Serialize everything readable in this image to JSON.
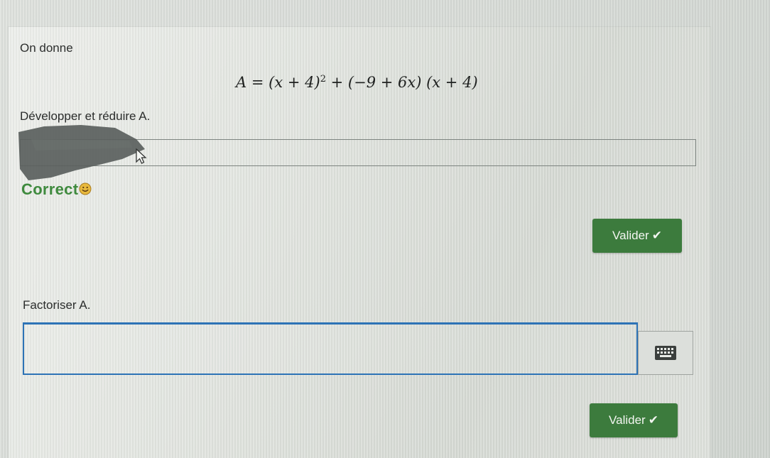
{
  "exercise": {
    "intro": "On donne",
    "formula": {
      "lhs": "A",
      "parts": [
        "(x + 4)",
        "2",
        "+ (−9 + 6x) (x + 4)"
      ]
    },
    "question1": {
      "prompt": "Développer et réduire A.",
      "feedback": "Correct",
      "validate_label": "Valider"
    },
    "question2": {
      "prompt": "Factoriser A.",
      "answer_value": "",
      "validate_label": "Valider"
    }
  },
  "icons": {
    "check": "check-icon",
    "keyboard": "keyboard-icon",
    "smiley": "smiley-icon"
  },
  "colors": {
    "validate_button": "#3c7b3d",
    "correct_text": "#3f8a3e",
    "input_focus_border": "#2d73b6"
  }
}
